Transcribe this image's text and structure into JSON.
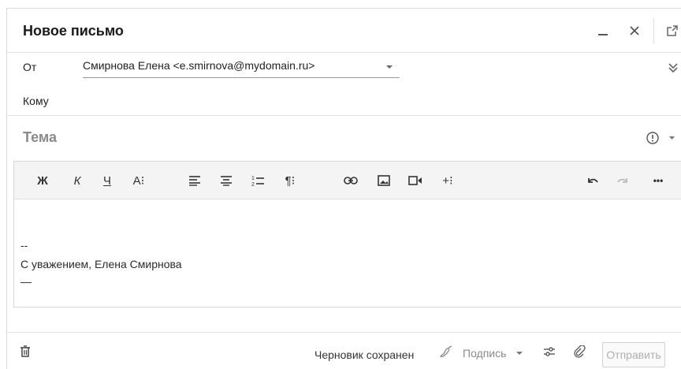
{
  "header": {
    "title": "Новое письмо",
    "minimize_icon": "minimize-icon",
    "close_icon": "close-icon",
    "popout_icon": "popout-icon"
  },
  "from": {
    "label": "От",
    "value": "Смирнова Елена <e.smirnova@mydomain.ru>",
    "expand_icon": "double-chevron-down-icon"
  },
  "to": {
    "label": "Кому"
  },
  "subject": {
    "placeholder": "Тема",
    "priority_icon": "priority-icon"
  },
  "toolbar": {
    "bold": "Ж",
    "italic": "К",
    "underline": "Ч",
    "font_size": "A⁝",
    "align_left_icon": "align-left-icon",
    "align_center_icon": "align-center-icon",
    "numbered_list_icon": "numbered-list-icon",
    "paragraph": "¶⁝",
    "link_icon": "link-icon",
    "image_icon": "image-icon",
    "video_icon": "video-icon",
    "insert": "+⁝",
    "undo_icon": "undo-icon",
    "redo_icon": "redo-icon",
    "more": "•••"
  },
  "body": {
    "sig_dash": "--",
    "sig_text": "С уважением, Елена Смирнова",
    "sig_line": "—"
  },
  "footer": {
    "status": "Черновик сохранен",
    "signature_label": "Подпись",
    "send_label": "Отправить"
  },
  "colors": {
    "toolbar_bg": "#f4f4f4",
    "border": "#d9d9d9",
    "muted": "#8a8a8a"
  }
}
